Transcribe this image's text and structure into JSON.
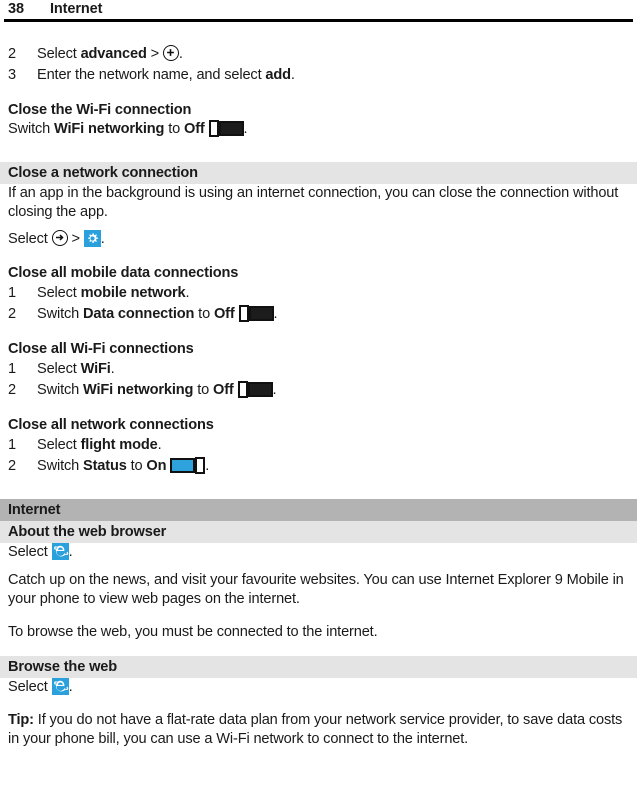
{
  "header": {
    "page_number": "38",
    "title": "Internet"
  },
  "colors": {
    "band_light": "#e4e4e4",
    "band_dark": "#b3b3b3",
    "tile_blue": "#2aa0dc",
    "toggle_on_blue": "#2da2dc",
    "toggle_off_dark": "#1c1c1c",
    "text": "#1a1a1a"
  },
  "steps_continued": [
    {
      "n": "2",
      "pre": "Select ",
      "bold": "advanced",
      "mid": " > ",
      "icon": "plus-circle-icon",
      "post": "."
    },
    {
      "n": "3",
      "pre": "Enter the network name, and select ",
      "bold": "add",
      "mid": "",
      "icon": "",
      "post": "."
    }
  ],
  "close_wifi": {
    "heading": "Close the Wi-Fi connection",
    "line_pre": "Switch ",
    "line_bold1": "WiFi networking",
    "line_mid": " to ",
    "line_bold2": "Off",
    "toggle_state": "off",
    "line_post": "."
  },
  "close_network_connection": {
    "band": "Close a network connection",
    "body": "If an app in the background is using an internet connection, you can close the connection without closing the app.",
    "select_pre": "Select ",
    "select_icon1": "arrow-right-circle-icon",
    "select_mid": " > ",
    "select_icon2": "settings-gear-tile-icon",
    "select_post": "."
  },
  "close_mobile_data": {
    "heading": "Close all mobile data connections",
    "steps": [
      {
        "n": "1",
        "pre": "Select ",
        "bold1": "mobile network",
        "mid": "",
        "bold2": "",
        "toggle": "",
        "post": "."
      },
      {
        "n": "2",
        "pre": "Switch ",
        "bold1": "Data connection",
        "mid": " to ",
        "bold2": "Off",
        "toggle": "off",
        "post": "."
      }
    ]
  },
  "close_wifi_all": {
    "heading": "Close all Wi-Fi connections",
    "steps": [
      {
        "n": "1",
        "pre": "Select ",
        "bold1": "WiFi",
        "mid": "",
        "bold2": "",
        "toggle": "",
        "post": "."
      },
      {
        "n": "2",
        "pre": "Switch ",
        "bold1": "WiFi networking",
        "mid": " to ",
        "bold2": "Off",
        "toggle": "off",
        "post": "."
      }
    ]
  },
  "close_all_network": {
    "heading": "Close all network connections",
    "steps": [
      {
        "n": "1",
        "pre": "Select ",
        "bold1": "flight mode",
        "mid": "",
        "bold2": "",
        "toggle": "",
        "post": "."
      },
      {
        "n": "2",
        "pre": "Switch ",
        "bold1": "Status",
        "mid": " to ",
        "bold2": "On",
        "toggle": "on",
        "post": "."
      }
    ]
  },
  "internet_chapter": {
    "band_dark": "Internet",
    "band_light": "About the web browser",
    "select_pre": "Select ",
    "select_icon": "internet-explorer-tile-icon",
    "select_post": ".",
    "para1": "Catch up on the news, and visit your favourite websites. You can use Internet Explorer 9 Mobile in your phone to view web pages on the internet.",
    "para2": "To browse the web, you must be connected to the internet."
  },
  "browse_the_web": {
    "band": "Browse the web",
    "select_pre": "Select ",
    "select_icon": "internet-explorer-tile-icon",
    "select_post": ".",
    "tip_label": "Tip:",
    "tip_text": " If you do not have a flat-rate data plan from your network service provider, to save data costs in your phone bill, you can use a Wi-Fi network to connect to the internet."
  }
}
